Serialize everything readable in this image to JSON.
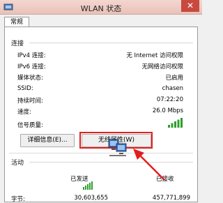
{
  "window": {
    "title": "WLAN 状态",
    "close_glyph": "✕",
    "icon": "network-adapter-icon"
  },
  "tabs": [
    {
      "label": "常规"
    }
  ],
  "connection": {
    "section_label": "连接",
    "rows": [
      {
        "label": "IPv4 连接:",
        "value": "无 Internet 访问权限"
      },
      {
        "label": "IPv6 连接:",
        "value": "无网络访问权限"
      },
      {
        "label": "媒体状态:",
        "value": "已启用"
      },
      {
        "label": "SSID:",
        "value": "chasen"
      },
      {
        "label": "持续时间:",
        "value": "07:22:20"
      },
      {
        "label": "速度:",
        "value": "26.0 Mbps"
      }
    ],
    "signal_label": "信号质量:",
    "signal_icon": "signal-strength-icon",
    "details_button": "详细信息(E)...",
    "wireless_props_button": "无线属性(W)"
  },
  "activity": {
    "section_label": "活动",
    "sent_label": "已发送",
    "received_label": "已接收",
    "bytes_label": "字节:",
    "bytes_sent": "30,603,655",
    "bytes_received": "457,771,899",
    "icon": "network-computers-icon"
  },
  "colors": {
    "titlebar": "#e9c2b8",
    "close_button": "#c7493f",
    "highlight_red": "#e02020",
    "signal_green": "#2e9e2e"
  }
}
